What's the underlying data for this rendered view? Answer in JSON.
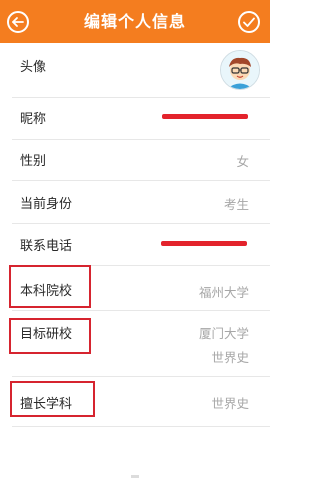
{
  "header": {
    "title": "编辑个人信息",
    "background_color": "#f47d1f",
    "back_icon": "back-arrow-icon",
    "confirm_icon": "check-icon"
  },
  "rows": {
    "avatar": {
      "label": "头像"
    },
    "nickname": {
      "label": "昵称"
    },
    "gender": {
      "label": "性别",
      "value": "女"
    },
    "identity": {
      "label": "当前身份",
      "value": "考生"
    },
    "phone": {
      "label": "联系电话"
    },
    "undergrad": {
      "label": "本科院校",
      "value": "福州大学"
    },
    "target_school": {
      "label": "目标研校",
      "value_school": "厦门大学",
      "value_major": "世界史"
    },
    "expertise": {
      "label": "擅长学科",
      "value": "世界史"
    }
  },
  "highlight_color": "#d6242f"
}
